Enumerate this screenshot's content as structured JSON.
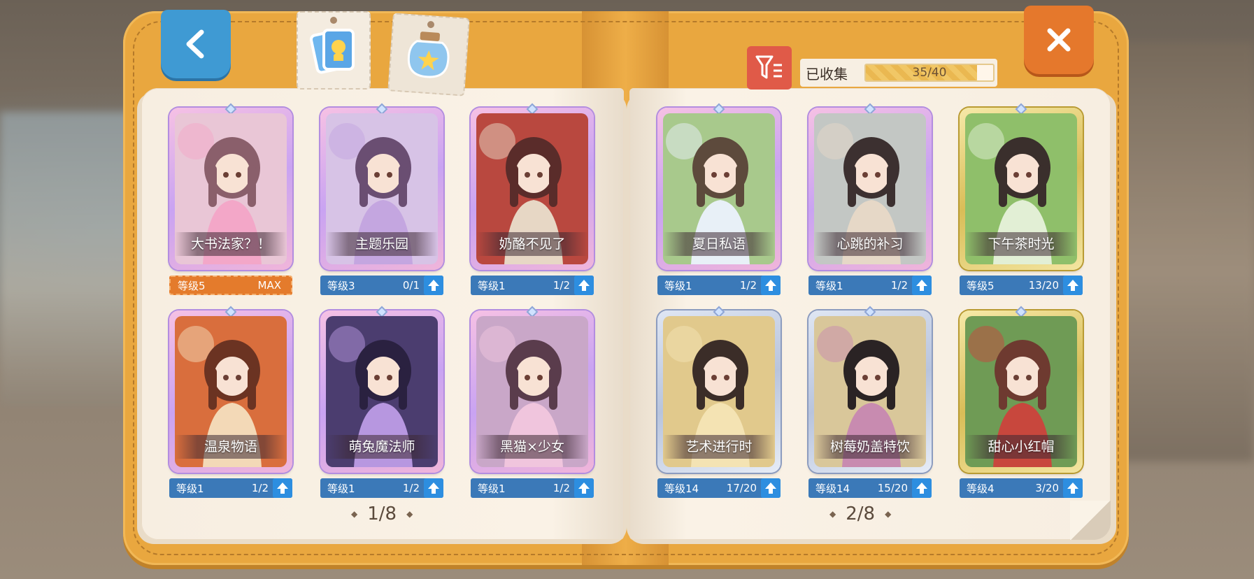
{
  "header": {
    "back_icon": "chevron-left-icon",
    "close_icon": "close-icon",
    "tabs": [
      {
        "icon": "card-collection-icon"
      },
      {
        "icon": "star-jar-icon"
      }
    ],
    "filter_icon": "filter-icon",
    "collection": {
      "label": "已收集",
      "progress_text": "35/40",
      "progress": 0.875
    }
  },
  "left_page": {
    "page_number": "1/8",
    "cards": [
      {
        "name": "大书法家？！",
        "level": "等级5",
        "progress": "MAX",
        "rarity": "pink",
        "maxed": true
      },
      {
        "name": "主题乐园",
        "level": "等级3",
        "progress": "0/1",
        "rarity": "pink",
        "maxed": false
      },
      {
        "name": "奶酪不见了",
        "level": "等级1",
        "progress": "1/2",
        "rarity": "pink",
        "maxed": false
      },
      {
        "name": "温泉物语",
        "level": "等级1",
        "progress": "1/2",
        "rarity": "pink",
        "maxed": false
      },
      {
        "name": "萌兔魔法师",
        "level": "等级1",
        "progress": "1/2",
        "rarity": "pink",
        "maxed": false
      },
      {
        "name": "黑猫×少女",
        "level": "等级1",
        "progress": "1/2",
        "rarity": "pink",
        "maxed": false
      }
    ]
  },
  "right_page": {
    "page_number": "2/8",
    "cards": [
      {
        "name": "夏日私语",
        "level": "等级1",
        "progress": "1/2",
        "rarity": "pink",
        "maxed": false
      },
      {
        "name": "心跳的补习",
        "level": "等级1",
        "progress": "1/2",
        "rarity": "pink",
        "maxed": false
      },
      {
        "name": "下午茶时光",
        "level": "等级5",
        "progress": "13/20",
        "rarity": "gold",
        "maxed": false
      },
      {
        "name": "艺术进行时",
        "level": "等级14",
        "progress": "17/20",
        "rarity": "silver",
        "maxed": false
      },
      {
        "name": "树莓奶盖特饮",
        "level": "等级14",
        "progress": "15/20",
        "rarity": "silver",
        "maxed": false
      },
      {
        "name": "甜心小红帽",
        "level": "等级4",
        "progress": "3/20",
        "rarity": "gold",
        "maxed": false
      }
    ]
  },
  "colors": {
    "cover": "#e9a73f",
    "back_button": "#3f9ad3",
    "close_button": "#e5782c",
    "level_blue": "#3b79b8",
    "level_max_orange": "#e47b2c",
    "filter_button": "#e05a48"
  }
}
